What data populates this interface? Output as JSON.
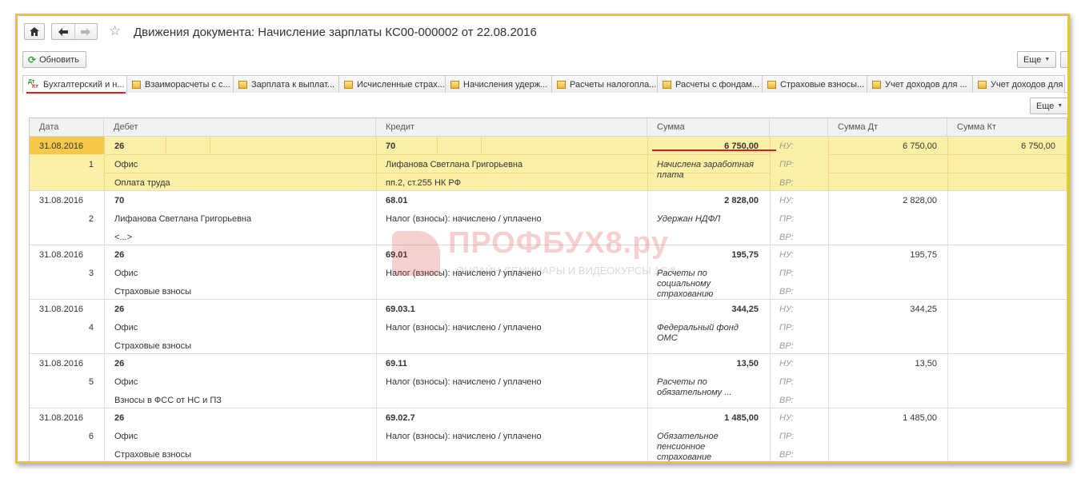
{
  "window": {
    "title": "Движения документа: Начисление зарплаты КС00-000002 от 22.08.2016"
  },
  "toolbar": {
    "refresh_label": "Обновить",
    "more_label": "Еще"
  },
  "tabs": [
    {
      "label": "Бухгалтерский и н...",
      "active": true
    },
    {
      "label": "Взаиморасчеты с с..."
    },
    {
      "label": "Зарплата к выплат..."
    },
    {
      "label": "Исчисленные страх..."
    },
    {
      "label": "Начисления удерж..."
    },
    {
      "label": "Расчеты налогопла..."
    },
    {
      "label": "Расчеты с фондам..."
    },
    {
      "label": "Страховые взносы..."
    },
    {
      "label": "Учет доходов для ..."
    },
    {
      "label": "Учет доходов для ..."
    }
  ],
  "table": {
    "more_label": "Еще",
    "columns": {
      "date": "Дата",
      "debit": "Дебет",
      "credit": "Кредит",
      "sum": "Сумма",
      "sum_dt": "Сумма Дт",
      "sum_kt": "Сумма Кт"
    },
    "rows": [
      {
        "date": "31.08.2016",
        "num": "1",
        "debit_account": "26",
        "debit_sub1": "Офис",
        "debit_sub2": "Оплата труда",
        "credit_account": "70",
        "credit_sub1": "Лифанова Светлана Григорьевна",
        "credit_sub2": "пп.2, ст.255 НК РФ",
        "sum": "6 750,00",
        "content": "Начислена заработная плата",
        "nu": "НУ:",
        "pr": "ПР:",
        "vr": "ВР:",
        "sum_dt": "6 750,00",
        "sum_kt": "6 750,00"
      },
      {
        "date": "31.08.2016",
        "num": "2",
        "debit_account": "70",
        "debit_sub1": "Лифанова Светлана Григорьевна",
        "debit_sub2": "<...>",
        "credit_account": "68.01",
        "credit_sub1": "Налог (взносы): начислено / уплачено",
        "credit_sub2": "",
        "sum": "2 828,00",
        "content": "Удержан НДФЛ",
        "nu": "НУ:",
        "pr": "ПР:",
        "vr": "ВР:",
        "sum_dt": "2 828,00",
        "sum_kt": ""
      },
      {
        "date": "31.08.2016",
        "num": "3",
        "debit_account": "26",
        "debit_sub1": "Офис",
        "debit_sub2": "Страховые взносы",
        "credit_account": "69.01",
        "credit_sub1": "Налог (взносы): начислено / уплачено",
        "credit_sub2": "",
        "sum": "195,75",
        "content": "Расчеты по социальному страхованию",
        "nu": "НУ:",
        "pr": "ПР:",
        "vr": "ВР:",
        "sum_dt": "195,75",
        "sum_kt": ""
      },
      {
        "date": "31.08.2016",
        "num": "4",
        "debit_account": "26",
        "debit_sub1": "Офис",
        "debit_sub2": "Страховые взносы",
        "credit_account": "69.03.1",
        "credit_sub1": "Налог (взносы): начислено / уплачено",
        "credit_sub2": "",
        "sum": "344,25",
        "content": "Федеральный фонд ОМС",
        "nu": "НУ:",
        "pr": "ПР:",
        "vr": "ВР:",
        "sum_dt": "344,25",
        "sum_kt": ""
      },
      {
        "date": "31.08.2016",
        "num": "5",
        "debit_account": "26",
        "debit_sub1": "Офис",
        "debit_sub2": "Взносы в ФСС от НС и ПЗ",
        "credit_account": "69.11",
        "credit_sub1": "Налог (взносы): начислено / уплачено",
        "credit_sub2": "",
        "sum": "13,50",
        "content": "Расчеты по обязательному ...",
        "nu": "НУ:",
        "pr": "ПР:",
        "vr": "ВР:",
        "sum_dt": "13,50",
        "sum_kt": ""
      },
      {
        "date": "31.08.2016",
        "num": "6",
        "debit_account": "26",
        "debit_sub1": "Офис",
        "debit_sub2": "Страховые взносы",
        "credit_account": "69.02.7",
        "credit_sub1": "Налог (взносы): начислено / уплачено",
        "credit_sub2": "",
        "sum": "1 485,00",
        "content": "Обязательное пенсионное страхование",
        "nu": "НУ:",
        "pr": "ПР:",
        "vr": "ВР:",
        "sum_dt": "1 485,00",
        "sum_kt": ""
      }
    ]
  },
  "watermark": {
    "brand": "ПРОФБУХ8.ру",
    "tagline": "ОНЛАЙН-СЕМИНАРЫ И ВИДЕОКУРСЫ 1С:8"
  },
  "colors": {
    "frame_border": "#e8c438",
    "selected_row": "#fcefa6",
    "selected_date": "#f6c94a",
    "highlight_underline": "#e21b1b"
  }
}
